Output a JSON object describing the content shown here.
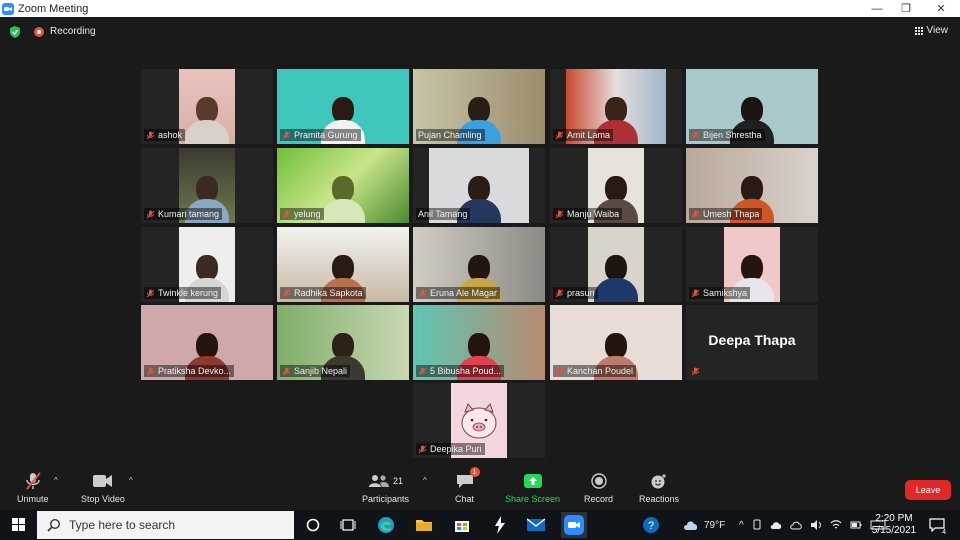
{
  "window": {
    "title": "Zoom Meeting",
    "controls": [
      "—",
      "❐",
      "✕"
    ]
  },
  "meeting_bar": {
    "recording_label": "Recording",
    "view_label": "View"
  },
  "participants": [
    {
      "name": "ashok"
    },
    {
      "name": "Pramita Gurung"
    },
    {
      "name": "Pujan Chamling"
    },
    {
      "name": "Amit Lama"
    },
    {
      "name": "Bijen Shrestha"
    },
    {
      "name": "Kumari tamang"
    },
    {
      "name": "yelung"
    },
    {
      "name": "Anil Tamang"
    },
    {
      "name": "Manju Waiba"
    },
    {
      "name": "Umesh Thapa"
    },
    {
      "name": "Twinkle kerung"
    },
    {
      "name": "Radhika Sapkota"
    },
    {
      "name": "Eruna Ale Magar"
    },
    {
      "name": "prasun"
    },
    {
      "name": "Samikshya"
    },
    {
      "name": "Pratiksha Devko..."
    },
    {
      "name": "Sanjib Nepali"
    },
    {
      "name": "5 Bibusha Poud..."
    },
    {
      "name": "Kanchan Poudel"
    },
    {
      "name": "Deepa Thapa"
    },
    {
      "name": "Deepika Puri"
    }
  ],
  "toolbar": {
    "unmute": "Unmute",
    "stop_video": "Stop Video",
    "participants": "Participants",
    "participants_count": "21",
    "chat": "Chat",
    "chat_badge": "1",
    "share_screen": "Share Screen",
    "record": "Record",
    "reactions": "Reactions",
    "leave": "Leave"
  },
  "taskbar": {
    "search_placeholder": "Type here to search",
    "weather": "79°F",
    "time": "2:20 PM",
    "date": "5/15/2021",
    "notification_count": "4"
  },
  "colors": {
    "accent": "#2d8cff",
    "share_green": "#23d959",
    "leave_red": "#e02828",
    "speaker_outline": "#dfe84c",
    "muted_red": "#e5533e"
  }
}
